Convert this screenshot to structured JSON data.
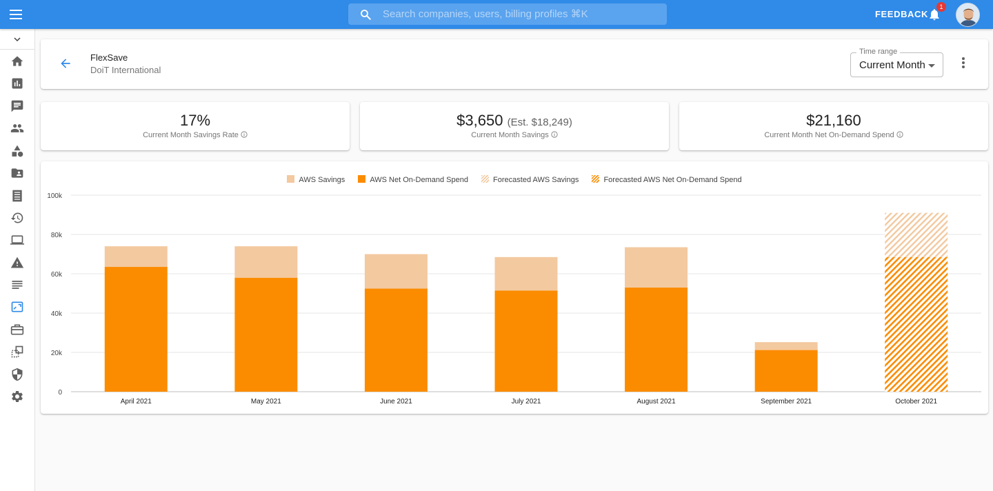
{
  "topbar": {
    "search_placeholder": "Search companies, users, billing profiles ⌘K",
    "feedback_label": "FEEDBACK",
    "notification_count": "1",
    "brand_color": "#2f8ae8"
  },
  "sidebar": {
    "items": [
      {
        "icon": "home-icon"
      },
      {
        "icon": "bar-chart-icon"
      },
      {
        "icon": "chat-icon"
      },
      {
        "icon": "people-icon"
      },
      {
        "icon": "shapes-icon"
      },
      {
        "icon": "folder-account-icon"
      },
      {
        "icon": "receipt-icon"
      },
      {
        "icon": "history-icon"
      },
      {
        "icon": "laptop-icon"
      },
      {
        "icon": "warning-icon"
      },
      {
        "icon": "list-icon"
      },
      {
        "icon": "flexsave-icon",
        "active": true
      },
      {
        "icon": "briefcase-icon"
      },
      {
        "icon": "swap-icon"
      },
      {
        "icon": "shield-icon"
      },
      {
        "icon": "gear-icon"
      }
    ]
  },
  "header": {
    "title": "FlexSave",
    "subtitle": "DoiT International",
    "time_range_label": "Time range",
    "time_range_value": "Current Month"
  },
  "kpis": [
    {
      "value": "17%",
      "est": "",
      "label": "Current Month Savings Rate"
    },
    {
      "value": "$3,650",
      "est": "(Est. $18,249)",
      "label": "Current Month Savings"
    },
    {
      "value": "$21,160",
      "est": "",
      "label": "Current Month Net On-Demand Spend"
    }
  ],
  "chart_data": {
    "type": "bar",
    "stacked": true,
    "categories": [
      "April 2021",
      "May 2021",
      "June 2021",
      "July 2021",
      "August 2021",
      "September 2021",
      "October 2021"
    ],
    "series": [
      {
        "name": "AWS Savings",
        "color": "#f3c9a0",
        "values": [
          10500,
          16000,
          17500,
          17000,
          20500,
          4000,
          0
        ]
      },
      {
        "name": "AWS Net On-Demand Spend",
        "color": "#fb8c00",
        "values": [
          63500,
          58000,
          52500,
          51500,
          53000,
          21200,
          0
        ]
      },
      {
        "name": "Forecasted AWS Savings",
        "color": "#f3c9a0",
        "pattern": "hatched",
        "values": [
          0,
          0,
          0,
          0,
          0,
          0,
          22500
        ]
      },
      {
        "name": "Forecasted AWS Net On-Demand Spend",
        "color": "#fb8c00",
        "pattern": "hatched",
        "values": [
          0,
          0,
          0,
          0,
          0,
          0,
          68500
        ]
      }
    ],
    "y_ticks": [
      "0",
      "20k",
      "40k",
      "60k",
      "80k",
      "100k"
    ],
    "ylim": [
      0,
      100000
    ],
    "grid": true,
    "legend_position": "top-center"
  }
}
